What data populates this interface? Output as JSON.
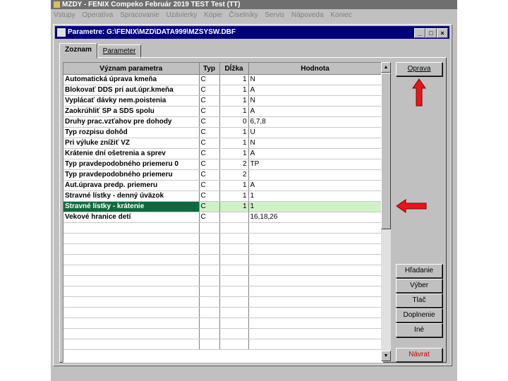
{
  "app": {
    "title": "MZDY - FENIX Compeko  Február 2019  TEST Test  (TT)"
  },
  "menu": [
    "Vstupy",
    "Operatíva",
    "Spracovanie",
    "Uzávierky",
    "Kópie",
    "Číselníky",
    "Servis",
    "Nápoveda",
    "Koniec"
  ],
  "window": {
    "title": "Parametre: G:\\FENIX\\MZD\\DATA999\\MZSYSW.DBF",
    "controls": {
      "minimize": "_",
      "maximize": "□",
      "close": "×"
    }
  },
  "tabs": [
    {
      "label": "Zoznam"
    },
    {
      "label": "Parameter"
    }
  ],
  "table": {
    "columns": [
      "Význam parametra",
      "Typ",
      "Dĺžka",
      "Hodnota"
    ],
    "rows": [
      {
        "name": "Automatická úprava kmeňa",
        "type": "C",
        "length": "1",
        "value": "N"
      },
      {
        "name": "Blokovať DDS pri aut.úpr.kmeňa",
        "type": "C",
        "length": "1",
        "value": "A"
      },
      {
        "name": "Vyplácať dávky nem.poistenia",
        "type": "C",
        "length": "1",
        "value": "N"
      },
      {
        "name": "Zaokrúhliť SP a SDS spolu",
        "type": "C",
        "length": "1",
        "value": "A"
      },
      {
        "name": "Druhy prac.vzťahov pre dohody",
        "type": "C",
        "length": "0",
        "value": "6,7,8"
      },
      {
        "name": "Typ rozpisu dohôd",
        "type": "C",
        "length": "1",
        "value": "U"
      },
      {
        "name": "Pri výluke znížiť VZ",
        "type": "C",
        "length": "1",
        "value": "N"
      },
      {
        "name": "Krátenie dní ošetrenia a sprev",
        "type": "C",
        "length": "1",
        "value": "A"
      },
      {
        "name": "Typ pravdepodobného priemeru 0",
        "type": "C",
        "length": "2",
        "value": "TP"
      },
      {
        "name": "Typ pravdepodobného priemeru",
        "type": "C",
        "length": "2",
        "value": ""
      },
      {
        "name": "Aut.úprava predp. priemeru",
        "type": "C",
        "length": "1",
        "value": "A"
      },
      {
        "name": "Stravné lístky - denný úväzok",
        "type": "C",
        "length": "1",
        "value": "1"
      },
      {
        "name": "Stravné lístky - krátenie",
        "type": "C",
        "length": "1",
        "value": "1"
      },
      {
        "name": "Vekové hranice detí",
        "type": "C",
        "length": "",
        "value": "16,18,26"
      }
    ]
  },
  "buttons": {
    "oprava": "Oprava",
    "hladanie": "Hľadanie",
    "vyber": "Výber",
    "tlac": "Tlač",
    "doplnenie": "Doplnenie",
    "ine": "Iné",
    "navrat": "Návrat"
  },
  "colors": {
    "selected_row": "#0b6b3f",
    "annotation_arrow": "#e8141c",
    "navrat_text": "#c00000"
  }
}
